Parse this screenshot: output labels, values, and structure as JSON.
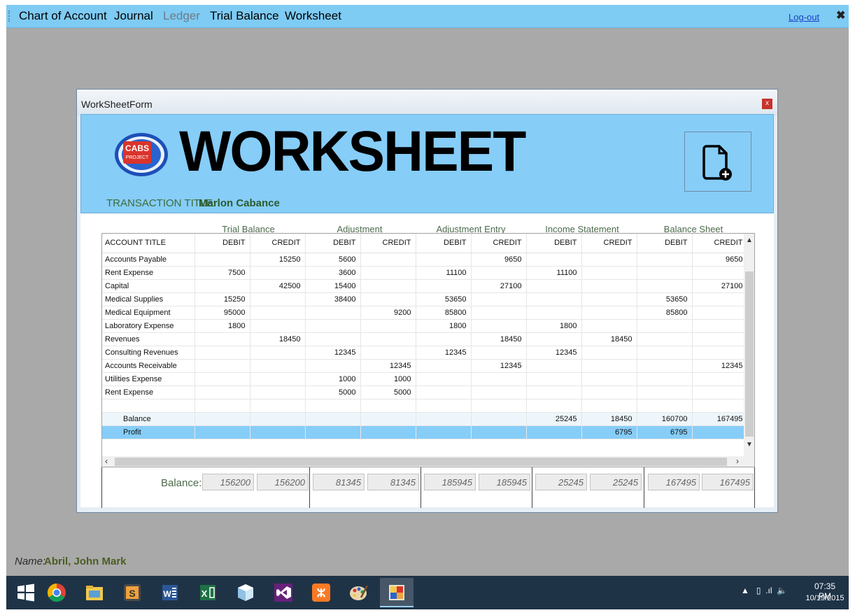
{
  "menu": {
    "items": [
      {
        "label": "Chart of Account"
      },
      {
        "label": "Journal"
      },
      {
        "label": "Ledger"
      },
      {
        "label": "Trial Balance"
      },
      {
        "label": "Worksheet"
      }
    ],
    "logout": "Log-out"
  },
  "form": {
    "title": "WorkSheetForm",
    "close": "x",
    "logo_text": "CABS PROJECT",
    "heading": "WORKSHEET",
    "transaction_title_label": "TRANSACTION TITLE:",
    "transaction_title_value": "Marlon Cabance"
  },
  "groups": [
    "Trial Balance",
    "Adjustment",
    "Adjustment Entry",
    "Income Statement",
    "Balance Sheet"
  ],
  "columns": [
    "ACCOUNT TITLE",
    "DEBIT",
    "CREDIT",
    "DEBIT",
    "CREDIT",
    "DEBIT",
    "CREDIT",
    "DEBIT",
    "CREDIT",
    "DEBIT",
    "CREDIT"
  ],
  "rows": [
    [
      "Accounts Payable",
      "",
      "15250",
      "5600",
      "",
      "",
      "9650",
      "",
      "",
      "",
      "9650"
    ],
    [
      "Rent Expense",
      "7500",
      "",
      "3600",
      "",
      "11100",
      "",
      "11100",
      "",
      "",
      ""
    ],
    [
      "Capital",
      "",
      "42500",
      "15400",
      "",
      "",
      "27100",
      "",
      "",
      "",
      "27100"
    ],
    [
      "Medical Supplies",
      "15250",
      "",
      "38400",
      "",
      "53650",
      "",
      "",
      "",
      "53650",
      ""
    ],
    [
      "Medical Equipment",
      "95000",
      "",
      "",
      "9200",
      "85800",
      "",
      "",
      "",
      "85800",
      ""
    ],
    [
      "Laboratory Expense",
      "1800",
      "",
      "",
      "",
      "1800",
      "",
      "1800",
      "",
      "",
      ""
    ],
    [
      "Revenues",
      "",
      "18450",
      "",
      "",
      "",
      "18450",
      "",
      "18450",
      "",
      ""
    ],
    [
      "Consulting Revenues",
      "",
      "",
      "12345",
      "",
      "12345",
      "",
      "12345",
      "",
      "",
      ""
    ],
    [
      "Accounts Receivable",
      "",
      "",
      "",
      "12345",
      "",
      "12345",
      "",
      "",
      "",
      "12345"
    ],
    [
      "Utilities Expense",
      "",
      "",
      "1000",
      "1000",
      "",
      "",
      "",
      "",
      "",
      ""
    ],
    [
      "Rent Expense",
      "",
      "",
      "5000",
      "5000",
      "",
      "",
      "",
      "",
      "",
      ""
    ],
    [
      "",
      "",
      "",
      "",
      "",
      "",
      "",
      "",
      "",
      "",
      ""
    ]
  ],
  "summary_rows": [
    [
      "Balance",
      "",
      "",
      "",
      "",
      "",
      "",
      "25245",
      "18450",
      "160700",
      "167495"
    ],
    [
      "Profit",
      "",
      "",
      "",
      "",
      "",
      "",
      "",
      "6795",
      "6795",
      ""
    ]
  ],
  "balance_label": "Balance:",
  "totals": [
    "156200",
    "156200",
    "81345",
    "81345",
    "185945",
    "185945",
    "25245",
    "25245",
    "167495",
    "167495"
  ],
  "user": {
    "name_label": "Name:",
    "name_value": "Abril, John Mark"
  },
  "taskbar": {
    "apps": [
      "windows-start",
      "chrome",
      "file-explorer",
      "sublime",
      "word",
      "excel",
      "app-box",
      "visual-studio",
      "xampp",
      "paint",
      "worksheet-app"
    ],
    "time": "07:35 PM",
    "date": "10/19/2015"
  }
}
